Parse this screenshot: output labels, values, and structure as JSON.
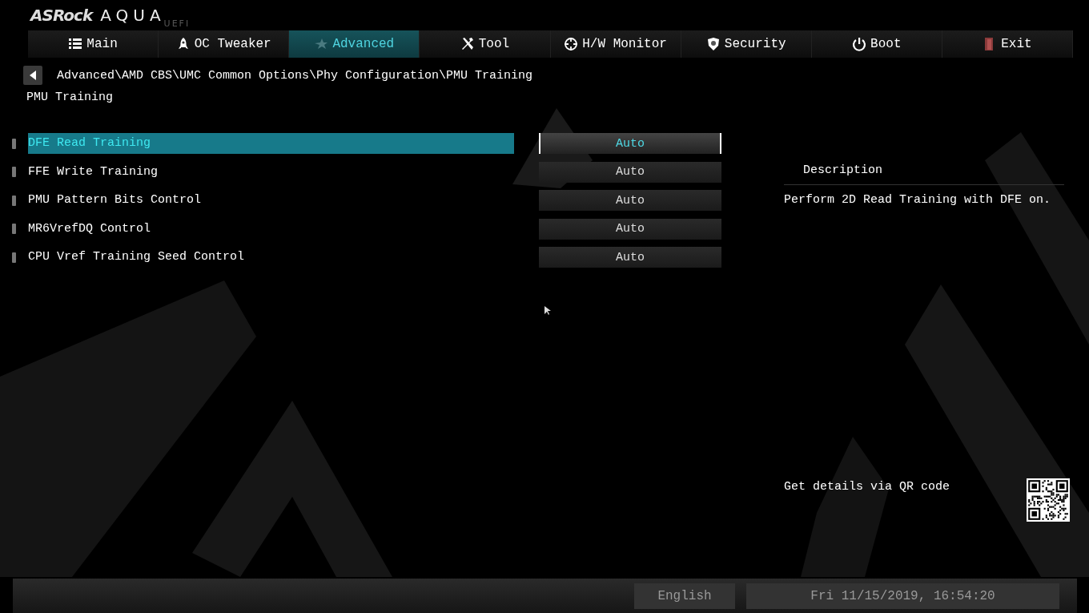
{
  "logo": {
    "brand": "ASRock",
    "product": "AQUA",
    "suffix": "UEFI"
  },
  "tabs": [
    {
      "label": "Main",
      "kind": "list",
      "selected": false
    },
    {
      "label": "OC Tweaker",
      "kind": "rocket",
      "selected": false
    },
    {
      "label": "Advanced",
      "kind": "star",
      "selected": true
    },
    {
      "label": "Tool",
      "kind": "tools",
      "selected": false
    },
    {
      "label": "H/W Monitor",
      "kind": "target",
      "selected": false
    },
    {
      "label": "Security",
      "kind": "shield",
      "selected": false
    },
    {
      "label": "Boot",
      "kind": "power",
      "selected": false
    },
    {
      "label": "Exit",
      "kind": "door",
      "selected": false
    }
  ],
  "breadcrumb": "Advanced\\AMD CBS\\UMC Common Options\\Phy Configuration\\PMU Training",
  "page_title": "PMU Training",
  "settings": [
    {
      "label": "DFE Read Training",
      "value": "Auto",
      "selected": true
    },
    {
      "label": "FFE Write Training",
      "value": "Auto",
      "selected": false
    },
    {
      "label": "PMU Pattern Bits Control",
      "value": "Auto",
      "selected": false
    },
    {
      "label": "MR6VrefDQ Control",
      "value": "Auto",
      "selected": false
    },
    {
      "label": "CPU Vref Training Seed Control",
      "value": "Auto",
      "selected": false
    }
  ],
  "description": {
    "title": "Description",
    "text": "Perform 2D Read Training with DFE on."
  },
  "qr_hint": "Get details via QR code",
  "status_bar": {
    "language": "English",
    "datetime": "Fri 11/15/2019, 16:54:20"
  }
}
